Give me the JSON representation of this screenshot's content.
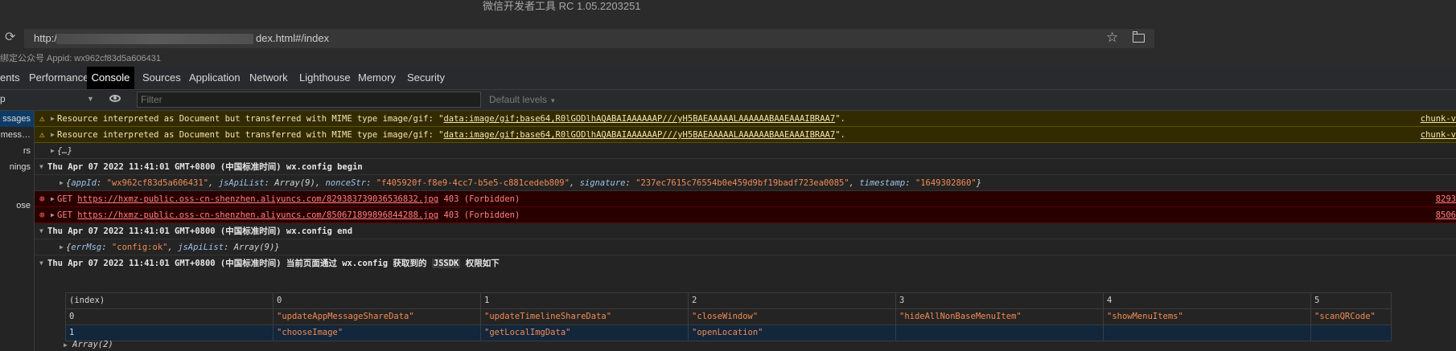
{
  "window": {
    "title": "微信开发者工具 RC 1.05.2203251"
  },
  "address": {
    "scheme": "http://",
    "tail": "dex.html#/index"
  },
  "appid_bar": {
    "text": "绑定公众号 Appid: wx962cf83d5a606431"
  },
  "devtools_tabs": [
    "ents",
    "Performance",
    "Console",
    "Sources",
    "Application",
    "Network",
    "Lighthouse",
    "Memory",
    "Security"
  ],
  "filter": {
    "context": "p",
    "placeholder": "Filter",
    "levels": "Default levels"
  },
  "sidebar": {
    "items": [
      "ssages",
      "mess…",
      "rs",
      "nings",
      "ose"
    ]
  },
  "console": {
    "warn_prefix": "Resource interpreted as Document but transferred with MIME type image/gif: \"",
    "warn_link": "data:image/gif;base64,R0lGODlhAQABAIAAAAAAP///yH5BAEAAAAALAAAAAABAAEAAAIBRAA7",
    "warn_suffix": "\".",
    "warn_source": "chunk-v",
    "collapsed_obj": "{…}",
    "group1": "Thu Apr 07 2022 11:41:01 GMT+0800 (中国标准时间) wx.config begin",
    "obj1": {
      "open": "{",
      "k1": "appId",
      "v1": "\"wx962cf83d5a606431\"",
      "k2": "jsApiList",
      "v2": "Array(9)",
      "k3": "nonceStr",
      "v3": "\"f405920f-f8e9-4cc7-b5e5-c881cedeb809\"",
      "k4": "signature",
      "v4": "\"237ec7615c76554b0e459d9bf19badf723ea0085\"",
      "k5": "timestamp",
      "v5": "\"1649302860\"",
      "close": "}"
    },
    "err1": {
      "method": "GET",
      "url": "https://hxmz-public.oss-cn-shenzhen.aliyuncs.com/829383739036536832.jpg",
      "status": "403 (Forbidden)",
      "source": "8293"
    },
    "err2": {
      "method": "GET",
      "url": "https://hxmz-public.oss-cn-shenzhen.aliyuncs.com/850671899896844288.jpg",
      "status": "403 (Forbidden)",
      "source": "8506"
    },
    "group2": "Thu Apr 07 2022 11:41:01 GMT+0800 (中国标准时间) wx.config end",
    "obj2": {
      "open": "{",
      "k1": "errMsg",
      "v1": "\"config:ok\"",
      "k2": "jsApiList",
      "v2": "Array(9)",
      "close": "}"
    },
    "group3_pre": "Thu Apr 07 2022 11:41:01 GMT+0800 (中国标准时间) 当前页面通过 wx.config 获取到的 ",
    "group3_code": "JSSDK",
    "group3_post": " 权限如下",
    "table": {
      "headers": [
        "(index)",
        "0",
        "1",
        "2",
        "3",
        "4",
        "5"
      ],
      "rows": [
        [
          "0",
          "\"updateAppMessageShareData\"",
          "\"updateTimelineShareData\"",
          "\"closeWindow\"",
          "\"hideAllNonBaseMenuItem\"",
          "\"showMenuItems\"",
          "\"scanQRCode\""
        ],
        [
          "1",
          "\"chooseImage\"",
          "\"getLocalImgData\"",
          "\"openLocation\"",
          "",
          "",
          ""
        ]
      ]
    },
    "array_row": "Array(2)"
  }
}
